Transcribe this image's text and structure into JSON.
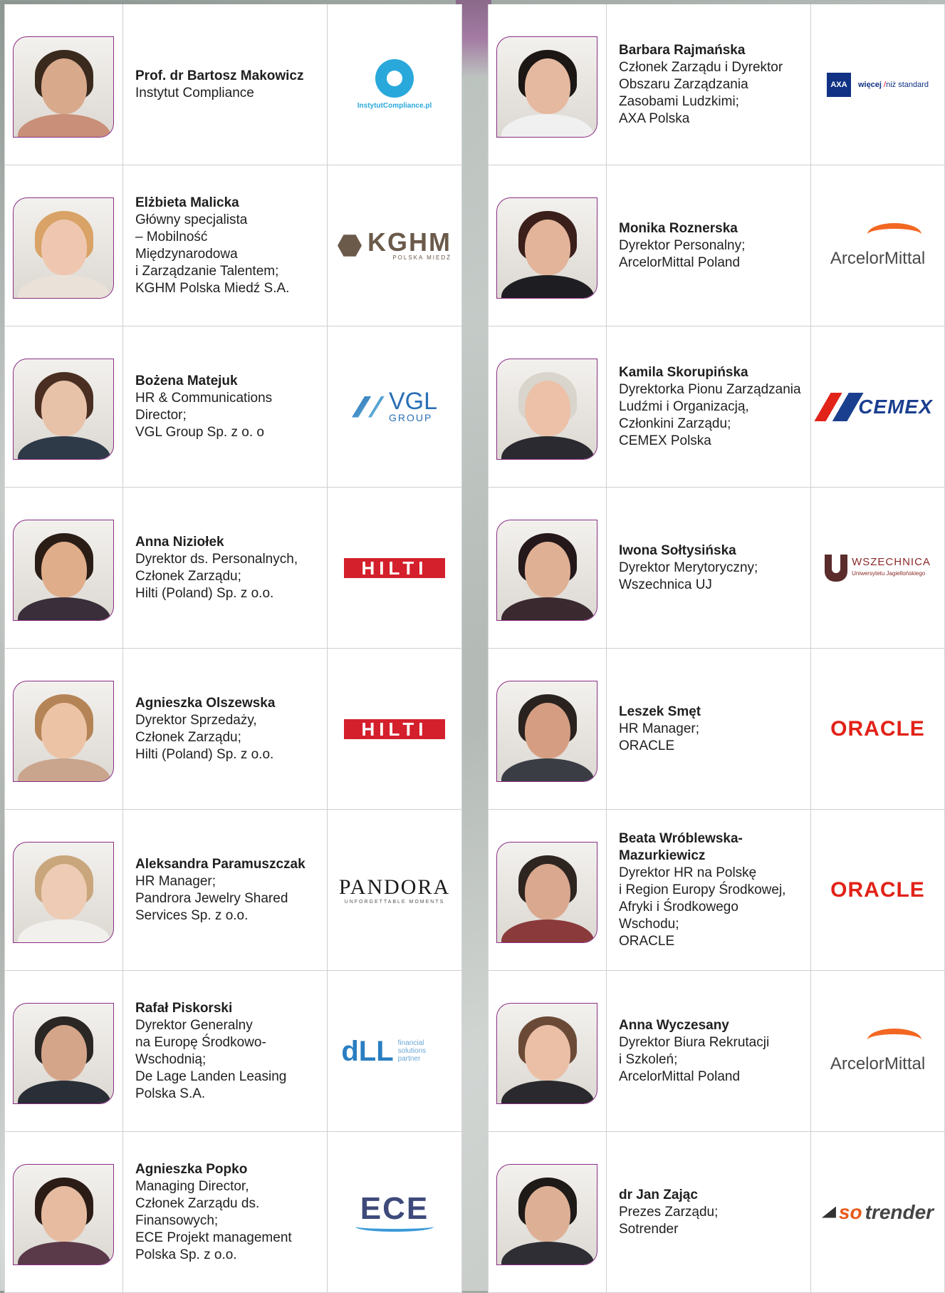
{
  "left": [
    {
      "name": "Prof. dr Bartosz Makowicz",
      "role": "Instytut Compliance",
      "logo": "instytut-compliance",
      "logo_text": "InstytutCompliance.pl",
      "skin": "#d9a98c",
      "hair": "#3a2a1e",
      "cloth": "#c98f78"
    },
    {
      "name": "Elżbieta Malicka",
      "role": "Główny specjalista\n– Mobilność\nMiędzynarodowa\ni Zarządzanie Talentem;\nKGHM Polska Miedź S.A.",
      "logo": "kghm",
      "logo_text": "KGHM",
      "logo_sub": "POLSKA MIEDŹ",
      "skin": "#efc7b0",
      "hair": "#d9a266",
      "cloth": "#eae2d8"
    },
    {
      "name": "Bożena Matejuk",
      "role": "HR & Communications\nDirector;\nVGL Group Sp. z o. o",
      "logo": "vgl",
      "logo_text": "VGL",
      "logo_sub": "GROUP",
      "skin": "#e8c2a8",
      "hair": "#4a2e22",
      "cloth": "#2e3a48"
    },
    {
      "name": "Anna Niziołek",
      "role": "Dyrektor ds. Personalnych,\nCzłonek Zarządu;\nHilti (Poland) Sp. z o.o.",
      "logo": "hilti",
      "logo_text": "HILTI",
      "skin": "#e0ad8a",
      "hair": "#2a1d16",
      "cloth": "#3a2e3a"
    },
    {
      "name": "Agnieszka Olszewska",
      "role": "Dyrektor Sprzedaży,\nCzłonek Zarządu;\nHilti (Poland) Sp. z o.o.",
      "logo": "hilti",
      "logo_text": "HILTI",
      "skin": "#edc3a6",
      "hair": "#b58456",
      "cloth": "#caa58d"
    },
    {
      "name": "Aleksandra Paramuszczak",
      "role": "HR Manager;\nPandrora Jewelry Shared\nServices Sp. z o.o.",
      "logo": "pandora",
      "logo_text": "PANDORA",
      "logo_sub": "UNFORGETTABLE MOMENTS",
      "skin": "#eecbb4",
      "hair": "#c9a67c",
      "cloth": "#f2f0ec"
    },
    {
      "name": "Rafał Piskorski",
      "role": "Dyrektor Generalny\nna Europę Środkowo-\nWschodnią;\nDe Lage Landen Leasing\nPolska S.A.",
      "logo": "dll",
      "logo_text": "dLL",
      "logo_sub": "financial solutions partner",
      "skin": "#d5a58a",
      "hair": "#2b2724",
      "cloth": "#2a2e36"
    },
    {
      "name": "Agnieszka Popko",
      "role": "Managing Director,\nCzłonek Zarządu ds.\nFinansowych;\nECE Projekt management\nPolska Sp. z o.o.",
      "logo": "ece",
      "logo_text": "ECE",
      "skin": "#e6bba0",
      "hair": "#2b1c16",
      "cloth": "#5a3a48"
    }
  ],
  "right": [
    {
      "name": "Barbara Rajmańska",
      "role": "Członek Zarządu i Dyrektor\nObszaru Zarządzania\nZasobami Ludzkimi;\nAXA Polska",
      "logo": "axa",
      "logo_text": "AXA",
      "logo_bold": "więcej",
      "logo_slash": "/",
      "logo_rest": "niż standard",
      "skin": "#e5b9a0",
      "hair": "#1c1614",
      "cloth": "#f0f0f0"
    },
    {
      "name": "Monika Roznerska",
      "role": "Dyrektor Personalny;\nArcelorMittal Poland",
      "logo": "arcelor",
      "logo_text": "ArcelorMittal",
      "skin": "#e3b49a",
      "hair": "#3a1f1a",
      "cloth": "#1e1e22"
    },
    {
      "name": "Kamila Skorupińska",
      "role": "Dyrektorka Pionu Zarządzania\nLudźmi i Organizacją,\nCzłonkini Zarządu;\nCEMEX Polska",
      "logo": "cemex",
      "logo_text": "CEMEX",
      "skin": "#ecc1a8",
      "hair": "#d9d4cc",
      "cloth": "#2a2a30"
    },
    {
      "name": "Iwona Sołtysińska",
      "role": "Dyrektor Merytoryczny;\nWszechnica UJ",
      "logo": "wszechnica",
      "logo_text": "WSZECHNICA",
      "logo_sub": "Uniwersytetu Jagiellońskiego",
      "skin": "#e0b095",
      "hair": "#24181a",
      "cloth": "#3a2a30"
    },
    {
      "name": "Leszek Smęt",
      "role": "HR Manager;\nORACLE",
      "logo": "oracle",
      "logo_text": "ORACLE",
      "skin": "#d59e82",
      "hair": "#2a221e",
      "cloth": "#3a3d44"
    },
    {
      "name": "Beata Wróblewska-\nMazurkiewicz",
      "role": "Dyrektor HR na Polskę\ni Region Europy Środkowej,\nAfryki i Środkowego\nWschodu;\nORACLE",
      "logo": "oracle",
      "logo_text": "ORACLE",
      "skin": "#d9a88e",
      "hair": "#2e2420",
      "cloth": "#8a3a3a"
    },
    {
      "name": "Anna Wyczesany",
      "role": "Dyrektor Biura Rekrutacji\ni Szkoleń;\nArcelorMittal Poland",
      "logo": "arcelor",
      "logo_text": "ArcelorMittal",
      "skin": "#ebbfa6",
      "hair": "#6a4a36",
      "cloth": "#2a2a2e"
    },
    {
      "name": "dr Jan Zając",
      "role": "Prezes Zarządu;\nSotrender",
      "logo": "sotrender",
      "logo_text": "so",
      "logo_text2": "trender",
      "skin": "#ddb095",
      "hair": "#1e1a18",
      "cloth": "#2e2e34"
    }
  ]
}
